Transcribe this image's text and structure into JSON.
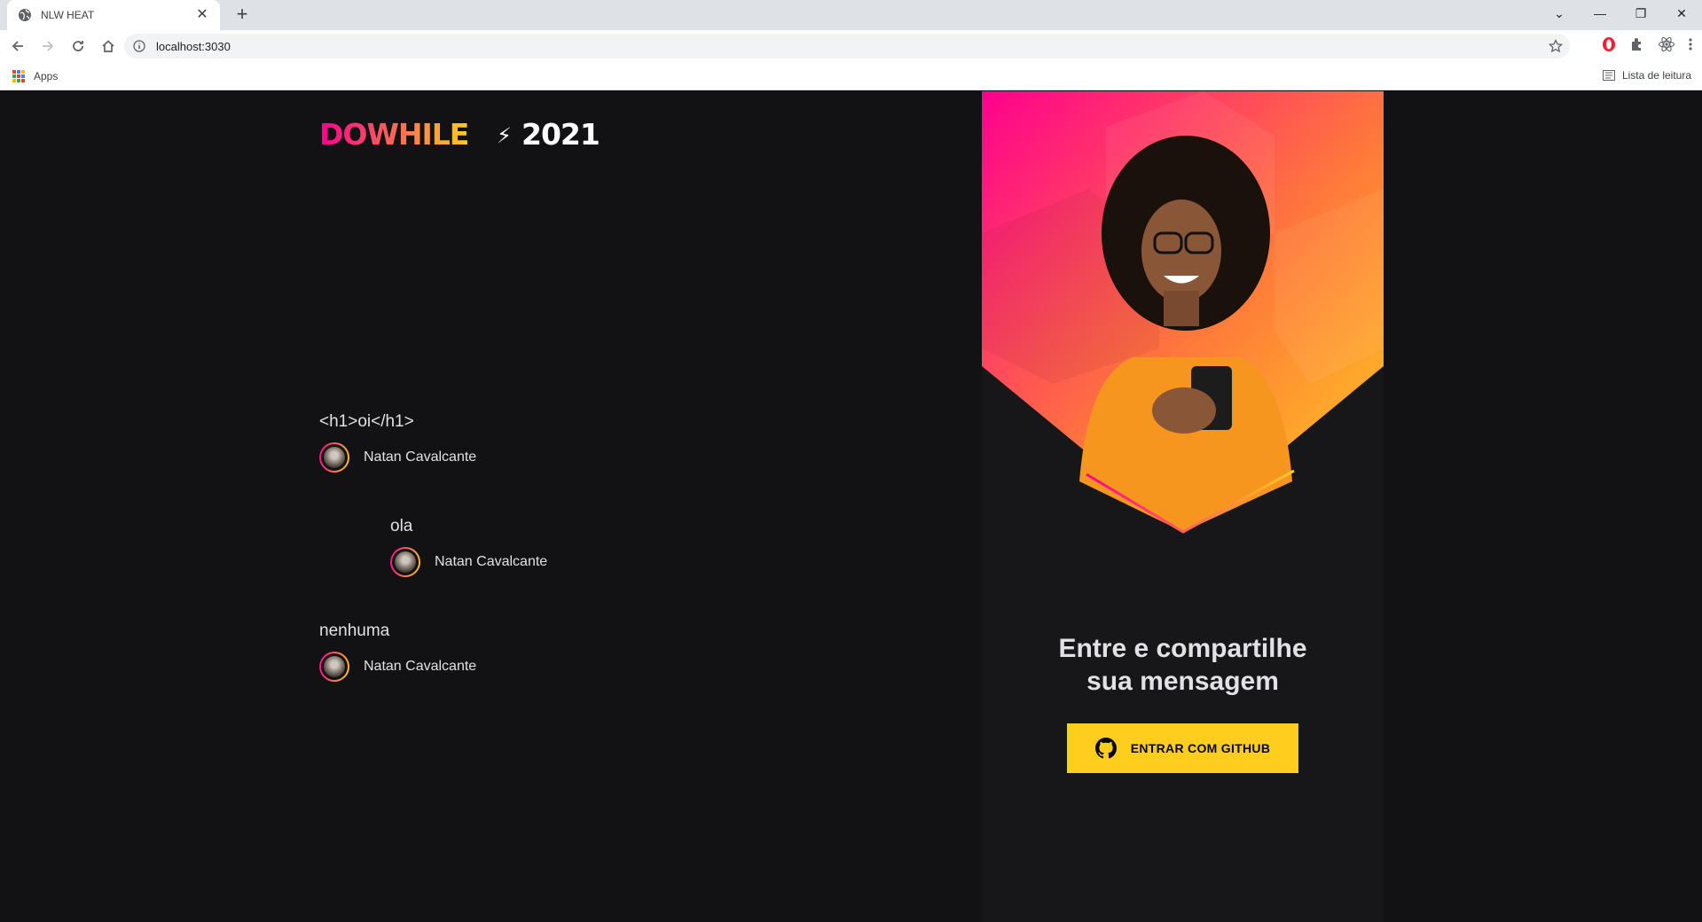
{
  "browser": {
    "tab_title": "NLW HEAT",
    "url": "localhost:3030",
    "bookmarks_apps": "Apps",
    "reading_list": "Lista de leitura"
  },
  "app": {
    "logo_text": "DOWHILE 2021",
    "messages": [
      {
        "content": "<h1>oi</h1>",
        "user": "Natan Cavalcante"
      },
      {
        "content": "ola",
        "user": "Natan Cavalcante"
      },
      {
        "content": "nenhuma",
        "user": "Natan Cavalcante"
      }
    ],
    "login": {
      "title_line1": "Entre e compartilhe",
      "title_line2": "sua mensagem",
      "button_label": "ENTRAR COM GITHUB"
    }
  },
  "colors": {
    "background": "#121214",
    "side_background": "#17171a",
    "accent_yellow": "#ffcd1e",
    "accent_pink": "#ff008e",
    "text": "#e1e1e6"
  }
}
